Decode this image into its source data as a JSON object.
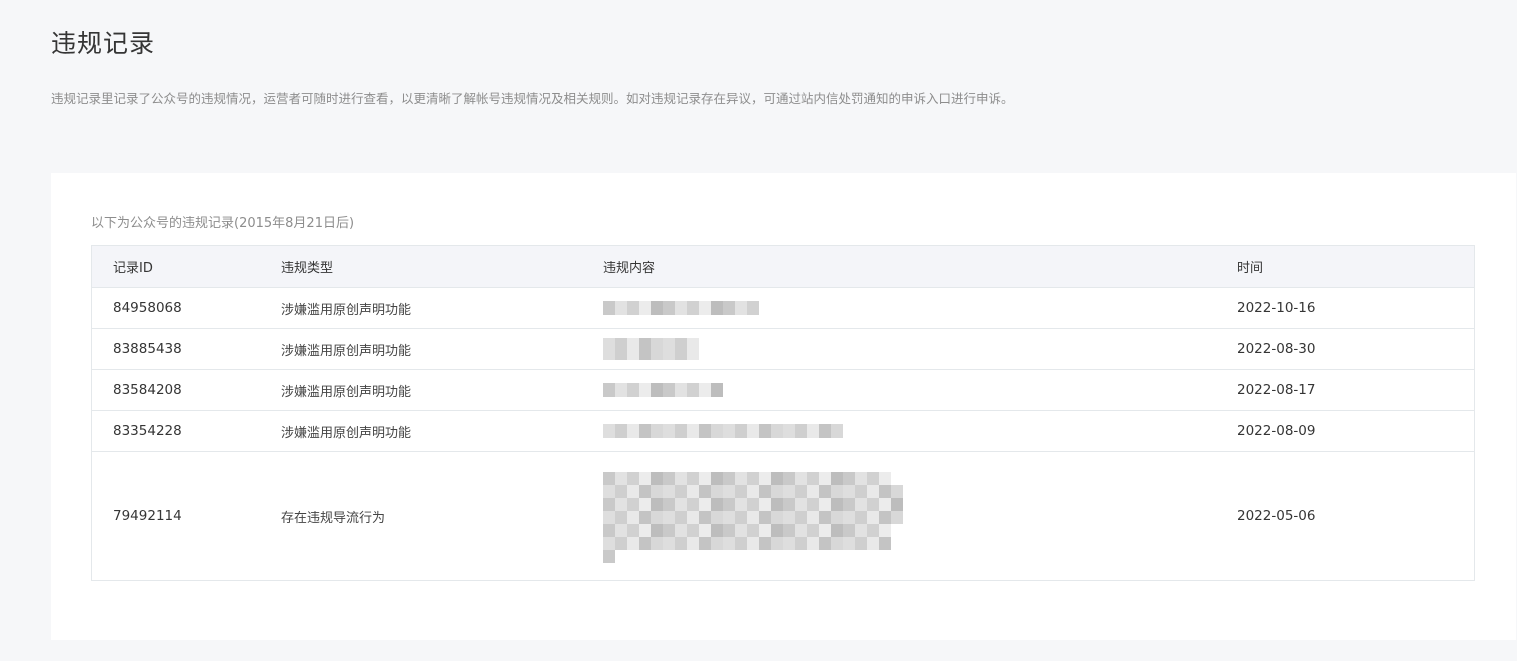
{
  "page": {
    "title": "违规记录",
    "description": "违规记录里记录了公众号的违规情况，运营者可随时进行查看，以更清晰了解帐号违规情况及相关规则。如对违规记录存在异议，可通过站内信处罚通知的申诉入口进行申诉。"
  },
  "card": {
    "caption": "以下为公众号的违规记录(2015年8月21日后)"
  },
  "table": {
    "headers": {
      "id": "记录ID",
      "type": "违规类型",
      "content": "违规内容",
      "time": "时间"
    },
    "rows": [
      {
        "id": "84958068",
        "type": "涉嫌滥用原创声明功能",
        "time": "2022-10-16"
      },
      {
        "id": "83885438",
        "type": "涉嫌滥用原创声明功能",
        "time": "2022-08-30"
      },
      {
        "id": "83584208",
        "type": "涉嫌滥用原创声明功能",
        "time": "2022-08-17"
      },
      {
        "id": "83354228",
        "type": "涉嫌滥用原创声明功能",
        "time": "2022-08-09"
      },
      {
        "id": "79492114",
        "type": "存在违规导流行为",
        "time": "2022-05-06"
      }
    ]
  }
}
